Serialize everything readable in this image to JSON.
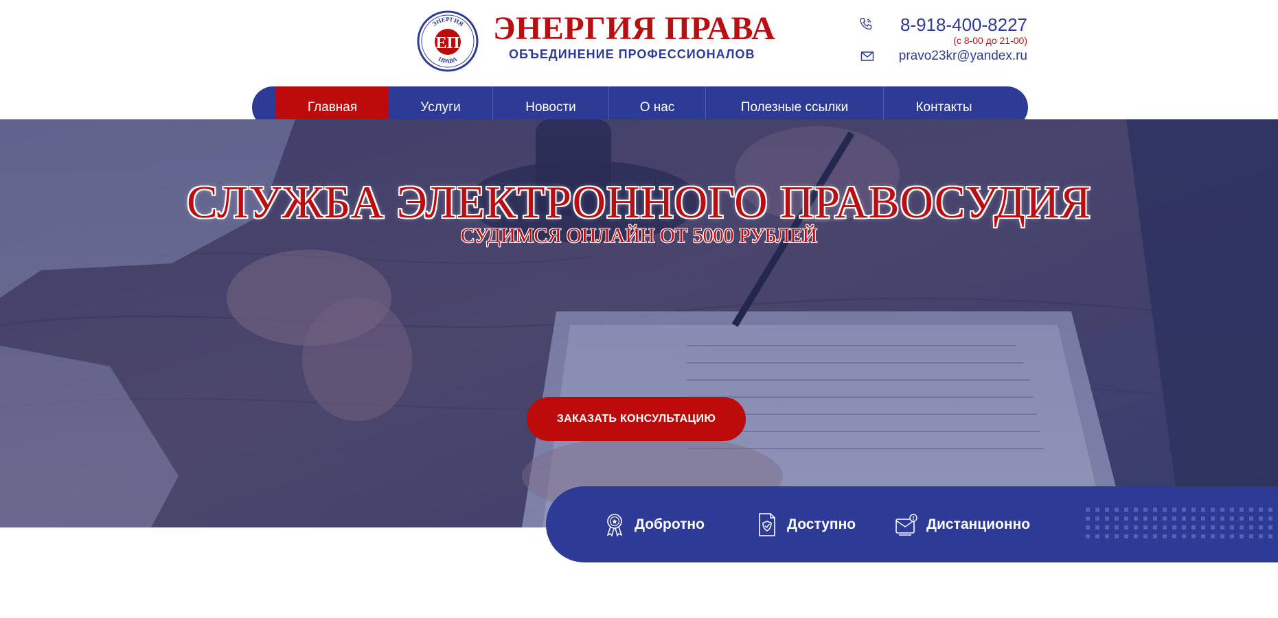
{
  "header": {
    "emblem": {
      "top_text": "ЭНЕРГИЯ",
      "monogram": "ЕП",
      "bottom_text": "ПРАВА"
    },
    "title": "ЭНЕРГИЯ ПРАВА",
    "subtitle": "ОБЪЕДИНЕНИЕ ПРОФЕССИОНАЛОВ",
    "phone": "8-918-400-8227",
    "hours": "(с 8-00 до 21-00)",
    "email": "pravo23kr@yandex.ru"
  },
  "nav": {
    "items": [
      {
        "label": "Главная"
      },
      {
        "label": "Услуги"
      },
      {
        "label": "Новости"
      },
      {
        "label": "О нас"
      },
      {
        "label": "Полезные ссылки"
      },
      {
        "label": "Контакты"
      }
    ],
    "active_index": 0
  },
  "hero": {
    "title": "СЛУЖБА ЭЛЕКТРОННОГО ПРАВОСУДИЯ",
    "subtitle": "СУДИМСЯ ОНЛАЙН ОТ 5000 РУБЛЕЙ",
    "cta_label": "ЗАКАЗАТЬ КОНСУЛЬТАЦИЮ"
  },
  "features": {
    "items": [
      {
        "label": "Добротно",
        "icon": "award-icon"
      },
      {
        "label": "Доступно",
        "icon": "document-shield-icon"
      },
      {
        "label": "Дистанционно",
        "icon": "online-mail-icon"
      }
    ]
  },
  "colors": {
    "brand_red": "#b80f12",
    "brand_blue": "#2e3b96",
    "accent_red": "#bd0a0a"
  }
}
